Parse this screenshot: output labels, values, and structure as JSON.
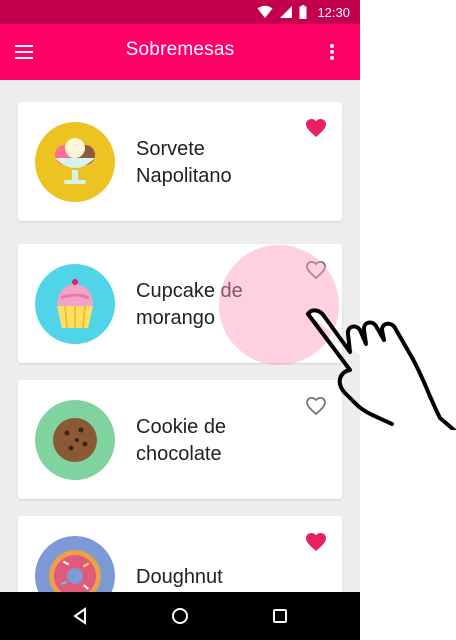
{
  "status_bar": {
    "time": "12:30"
  },
  "app_bar": {
    "title": "Sobremesas"
  },
  "items": [
    {
      "name_line1": "Sorvete",
      "name_line2": "Napolitano",
      "favorite": true,
      "icon": "ice-cream-icon",
      "bg": "#ecc320"
    },
    {
      "name_line1": "Cupcake de",
      "name_line2": "morango",
      "favorite": false,
      "icon": "cupcake-icon",
      "bg": "#4fd4e8"
    },
    {
      "name_line1": "Cookie de",
      "name_line2": "chocolate",
      "favorite": false,
      "icon": "cookie-icon",
      "bg": "#7ed39e"
    },
    {
      "name_line1": "Doughnut",
      "name_line2": "",
      "favorite": true,
      "icon": "doughnut-icon",
      "bg": "#7d9ad6"
    }
  ],
  "colors": {
    "primary": "#ff0066",
    "status": "#c2004e",
    "favorite": "#e91e63"
  }
}
